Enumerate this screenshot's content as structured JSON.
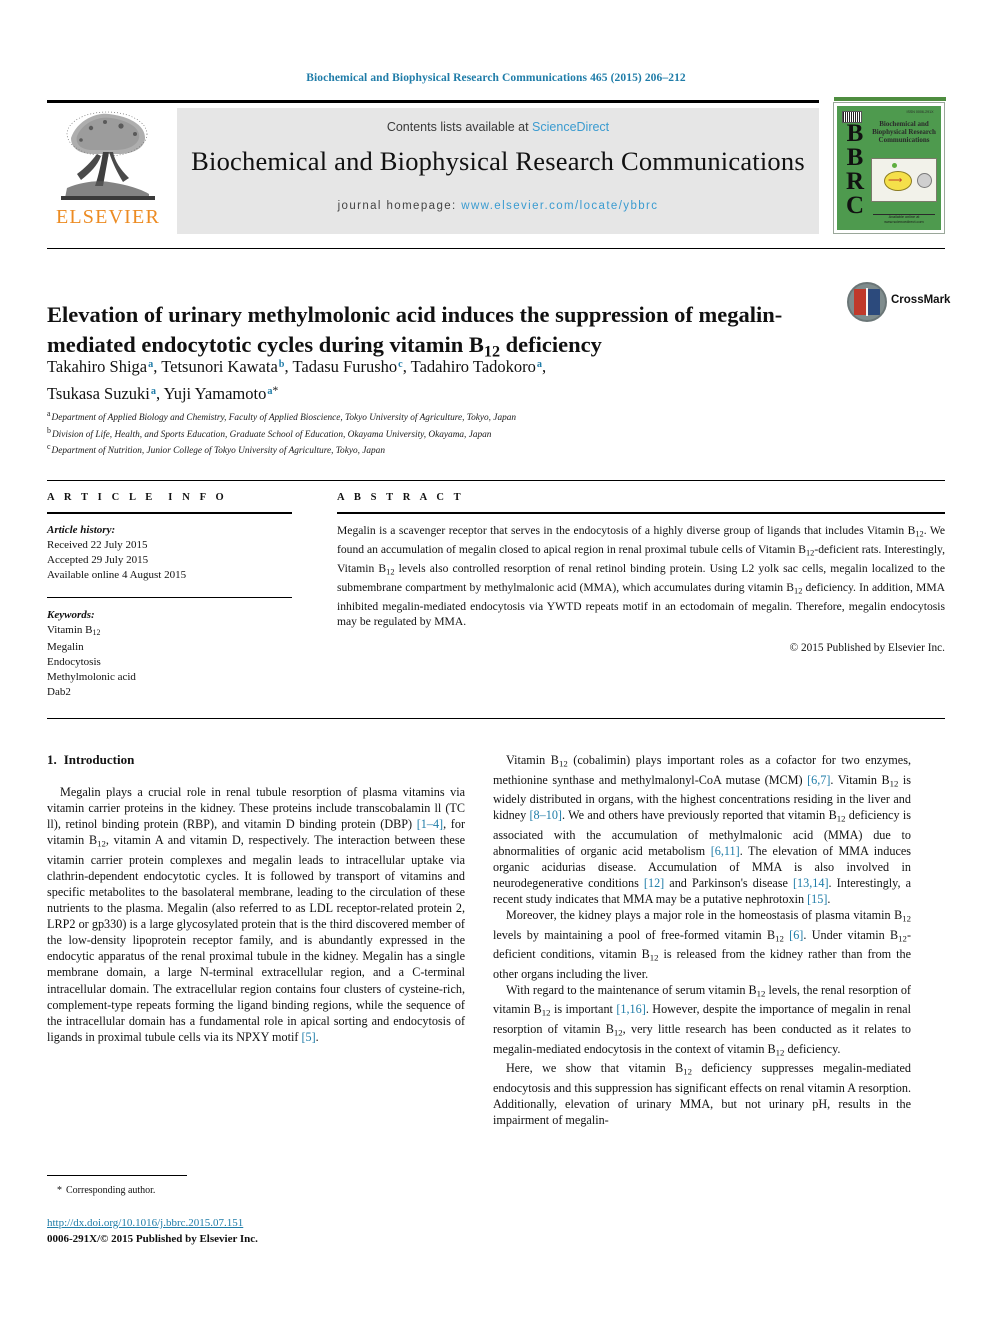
{
  "running_head": "Biochemical and Biophysical Research Communications 465 (2015) 206–212",
  "masthead": {
    "contents_prefix": "Contents lists available at ",
    "sciencedirect": "ScienceDirect",
    "journal_title": "Biochemical and Biophysical Research Communications",
    "homepage_label": "journal homepage: ",
    "homepage_url": "www.elsevier.com/locate/ybbrc",
    "publisher": "ELSEVIER",
    "cover": {
      "bbrc": "B\nB\nR\nC",
      "title_lines": "Biochemical and Biophysical Research Communications",
      "top_small": "ISSN 0006-291X",
      "bottom_small": "Available online at www.sciencedirect.com"
    }
  },
  "article": {
    "title": "Elevation of urinary methylmolonic acid induces the suppression of megalin-mediated endocytotic cycles during vitamin B12 deficiency",
    "title_part1": "Elevation of urinary methylmolonic acid induces the suppression of megalin-mediated endocytotic cycles during vitamin B",
    "title_sub": "12",
    "title_part2": " deficiency",
    "crossmark_label": "CrossMark",
    "authors": [
      {
        "name": "Takahiro Shiga",
        "mark": "a",
        "sep": ", "
      },
      {
        "name": "Tetsunori Kawata",
        "mark": "b",
        "sep": ", "
      },
      {
        "name": "Tadasu Furusho",
        "mark": "c",
        "sep": ", "
      },
      {
        "name": "Tadahiro Tadokoro",
        "mark": "a",
        "sep": ", "
      },
      {
        "name": "Tsukasa Suzuki",
        "mark": "a",
        "sep": ", "
      },
      {
        "name": "Yuji Yamamoto",
        "mark": "a",
        "corr": "*",
        "sep": ""
      }
    ],
    "affiliations": [
      {
        "mark": "a",
        "text": "Department of Applied Biology and Chemistry, Faculty of Applied Bioscience, Tokyo University of Agriculture, Tokyo, Japan"
      },
      {
        "mark": "b",
        "text": "Division of Life, Health, and Sports Education, Graduate School of Education, Okayama University, Okayama, Japan"
      },
      {
        "mark": "c",
        "text": "Department of Nutrition, Junior College of Tokyo University of Agriculture, Tokyo, Japan"
      }
    ]
  },
  "article_info": {
    "heading": "ARTICLE INFO",
    "history_label": "Article history:",
    "history": [
      "Received 22 July 2015",
      "Accepted 29 July 2015",
      "Available online 4 August 2015"
    ],
    "keywords_label": "Keywords:",
    "keywords": [
      "Vitamin B12",
      "Megalin",
      "Endocytosis",
      "Methylmolonic acid",
      "Dab2"
    ]
  },
  "abstract": {
    "heading": "ABSTRACT",
    "text": "Megalin is a scavenger receptor that serves in the endocytosis of a highly diverse group of ligands that includes Vitamin B12. We found an accumulation of megalin closed to apical region in renal proximal tubule cells of Vitamin B12-deficient rats. Interestingly, Vitamin B12 levels also controlled resorption of renal retinol binding protein. Using L2 yolk sac cells, megalin localized to the submembrane compartment by methylmalonic acid (MMA), which accumulates during vitamin B12 deficiency. In addition, MMA inhibited megalin-mediated endocytosis via YWTD repeats motif in an ectodomain of megalin. Therefore, megalin endocytosis may be regulated by MMA.",
    "copyright": "© 2015 Published by Elsevier Inc."
  },
  "body": {
    "section_number": "1.",
    "section_title": "Introduction",
    "left_paragraphs": [
      "Megalin plays a crucial role in renal tubule resorption of plasma vitamins via vitamin carrier proteins in the kidney. These proteins include transcobalamin ll (TC ll), retinol binding protein (RBP), and vitamin D binding protein (DBP) [1–4], for vitamin B12, vitamin A and vitamin D, respectively. The interaction between these vitamin carrier protein complexes and megalin leads to intracellular uptake via clathrin-dependent endocytotic cycles. It is followed by transport of vitamins and specific metabolites to the basolateral membrane, leading to the circulation of these nutrients to the plasma. Megalin (also referred to as LDL receptor-related protein 2, LRP2 or gp330) is a large glycosylated protein that is the third discovered member of the low-density lipoprotein receptor family, and is abundantly expressed in the endocytic apparatus of the renal proximal tubule in the kidney. Megalin has a single membrane domain, a large N-terminal extracellular region, and a C-terminal intracellular domain. The extracellular region contains four clusters of cysteine-rich, complement-type repeats forming the ligand binding regions, while the sequence of the intracellular domain has a fundamental role in apical sorting and endocytosis of ligands in proximal tubule cells via its NPXY motif [5]."
    ],
    "right_paragraphs": [
      "Vitamin B12 (cobalimin) plays important roles as a cofactor for two enzymes, methionine synthase and methylmalonyl-CoA mutase (MCM) [6,7]. Vitamin B12 is widely distributed in organs, with the highest concentrations residing in the liver and kidney [8–10]. We and others have previously reported that vitamin B12 deficiency is associated with the accumulation of methylmalonic acid (MMA) due to abnormalities of organic acid metabolism [6,11]. The elevation of MMA induces organic acidurias disease. Accumulation of MMA is also involved in neurodegenerative conditions [12] and Parkinson's disease [13,14]. Interestingly, a recent study indicates that MMA may be a putative nephrotoxin [15].",
      "Moreover, the kidney plays a major role in the homeostasis of plasma vitamin B12 levels by maintaining a pool of free-formed vitamin B12 [6]. Under vitamin B12-deficient conditions, vitamin B12 is released from the kidney rather than from the other organs including the liver.",
      "With regard to the maintenance of serum vitamin B12 levels, the renal resorption of vitamin B12 is important [1,16]. However, despite the importance of megalin in renal resorption of vitamin B12, very little research has been conducted as it relates to megalin-mediated endocytosis in the context of vitamin B12 deficiency.",
      "Here, we show that vitamin B12 deficiency suppresses megalin-mediated endocytosis and this suppression has significant effects on renal vitamin A resorption. Additionally, elevation of urinary MMA, but not urinary pH, results in the impairment of megalin-"
    ]
  },
  "footer": {
    "corresponding": "Corresponding author.",
    "corresponding_star": "*",
    "doi": "http://dx.doi.org/10.1016/j.bbrc.2015.07.151",
    "issn_line": "0006-291X/© 2015 Published by Elsevier Inc."
  },
  "colors": {
    "link": "#1f7ca8",
    "sciencedirect": "#3a9bd0",
    "elsevier_orange": "#ec8b22",
    "band_gray": "#e6e6e6",
    "cover_green": "#4e9a4e"
  }
}
